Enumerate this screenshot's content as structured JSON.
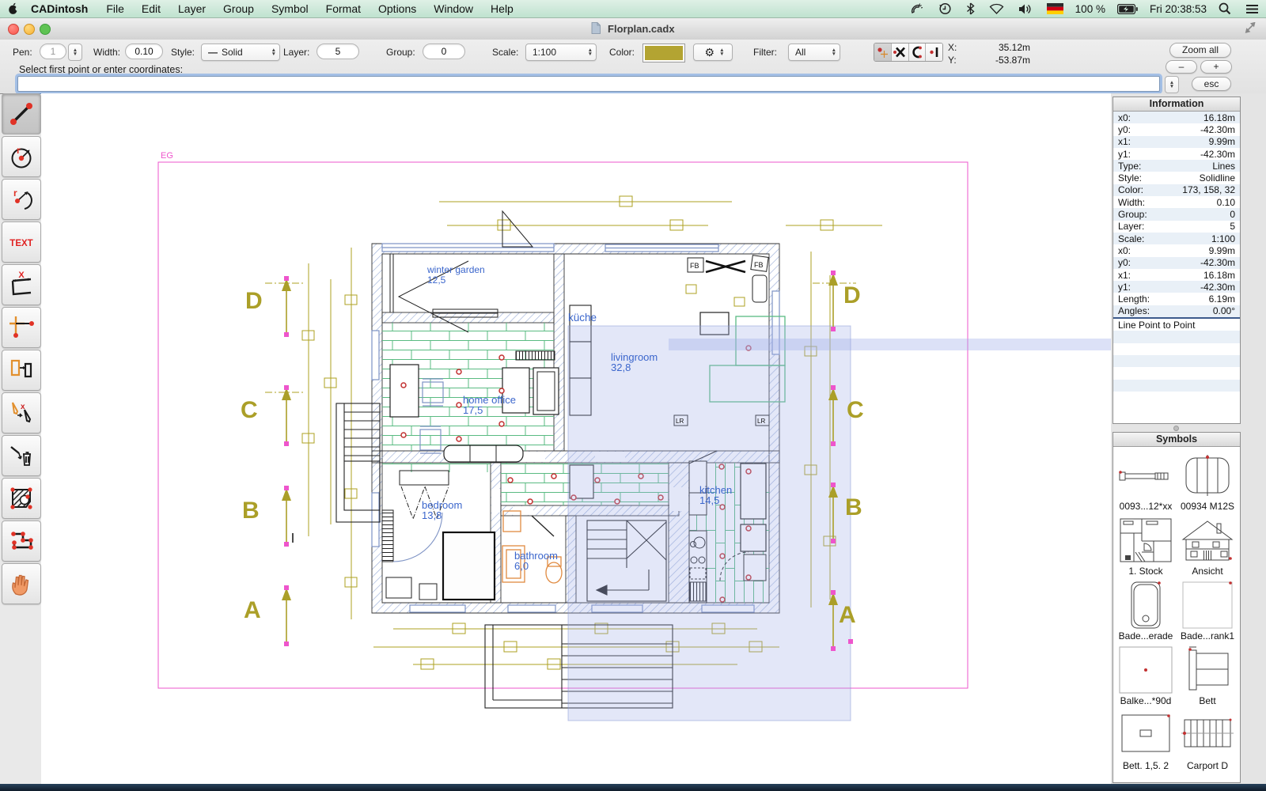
{
  "menu_bar": {
    "app_name": "CADintosh",
    "menus": [
      "File",
      "Edit",
      "Layer",
      "Group",
      "Symbol",
      "Format",
      "Options",
      "Window",
      "Help"
    ],
    "battery": "100 %",
    "clock": "Fri 20:38:53",
    "status_icons": [
      "phone-icon",
      "time-machine-icon",
      "bluetooth-icon",
      "wifi-icon",
      "volume-icon",
      "keyboard-flag-de-icon",
      "battery-icon",
      "spotlight-icon",
      "notification-center-icon"
    ]
  },
  "window": {
    "title": "Florplan.cadx"
  },
  "toolbar": {
    "pen_label": "Pen:",
    "pen": "1",
    "width_label": "Width:",
    "width": "0.10",
    "style_label": "Style:",
    "style_dash": "—",
    "style": "Solid",
    "layer_label": "Layer:",
    "layer": "5",
    "group_label": "Group:",
    "group": "0",
    "scale_label": "Scale:",
    "scale": "1:100",
    "color_label": "Color:",
    "gear": "⚙",
    "filter_label": "Filter:",
    "filter": "All",
    "x_label": "X:",
    "x_value": "35.12m",
    "y_label": "Y:",
    "y_value": "-53.87m",
    "zoom_all": "Zoom all",
    "zoom_out": "–",
    "zoom_in": "+",
    "esc": "esc"
  },
  "prompt": {
    "label": "Select first point or enter coordinates:",
    "value": ""
  },
  "tools": {
    "text_label": "TEXT",
    "r_label": "r",
    "x_label": "X",
    "names": [
      "line",
      "circle",
      "arc",
      "text",
      "dimension",
      "axis",
      "copy",
      "edit-copy",
      "delete",
      "hatch",
      "polyline",
      "pan"
    ]
  },
  "info_panel": {
    "title": "Information",
    "rows": [
      {
        "label": "x0:",
        "value": "16.18m"
      },
      {
        "label": "y0:",
        "value": "-42.30m"
      },
      {
        "label": "x1:",
        "value": "9.99m"
      },
      {
        "label": "y1:",
        "value": "-42.30m"
      },
      {
        "label": "Type:",
        "value": "Lines"
      },
      {
        "label": "Style:",
        "value": "Solidline"
      },
      {
        "label": "Color:",
        "value": "173, 158, 32"
      },
      {
        "label": "Width:",
        "value": "0.10"
      },
      {
        "label": "Group:",
        "value": "0"
      },
      {
        "label": "Layer:",
        "value": "5"
      },
      {
        "label": "Scale:",
        "value": "1:100"
      },
      {
        "label": "x0:",
        "value": "9.99m"
      },
      {
        "label": "y0:",
        "value": "-42.30m"
      },
      {
        "label": "x1:",
        "value": "16.18m"
      },
      {
        "label": "y1:",
        "value": "-42.30m"
      },
      {
        "label": "Length:",
        "value": "6.19m"
      },
      {
        "label": "Angles:",
        "value": "0.00°"
      }
    ],
    "mode": "Line Point to Point"
  },
  "symbols_panel": {
    "title": "Symbols",
    "items": [
      {
        "label": "0093...12*xx",
        "icon": "bolt"
      },
      {
        "label": "00934 M12S",
        "icon": "nut"
      },
      {
        "label": "1. Stock",
        "icon": "floorplan"
      },
      {
        "label": "Ansicht",
        "icon": "house-elevation"
      },
      {
        "label": "Bade...erade",
        "icon": "bathtub"
      },
      {
        "label": "Bade...rank1",
        "icon": "blank-frame"
      },
      {
        "label": "Balke...*90d",
        "icon": "beam"
      },
      {
        "label": "Bett",
        "icon": "bed"
      },
      {
        "label": "Bett. 1,5. 2",
        "icon": "bed-2"
      },
      {
        "label": "Carport D",
        "icon": "carport"
      }
    ]
  },
  "canvas": {
    "plan_label": "EG",
    "rooms": [
      {
        "name": "winter garden",
        "area": "12,5"
      },
      {
        "name": "küche",
        "area": ""
      },
      {
        "name": "livingroom",
        "area": "32,8"
      },
      {
        "name": "home office",
        "area": "17,5"
      },
      {
        "name": "bedroom",
        "area": "13,8"
      },
      {
        "name": "bathroom",
        "area": "6,0"
      },
      {
        "name": "kitchen",
        "area": "14,5"
      }
    ],
    "markers": {
      "left": [
        "D",
        "C",
        "B",
        "A"
      ],
      "right": [
        "D",
        "C",
        "B",
        "A"
      ]
    },
    "tags": {
      "fb": "FB",
      "lr": "LR"
    },
    "colors": {
      "dimension_olive": "#ada020",
      "frame_magenta": "#ee55cc",
      "tile_green": "#5abb82",
      "wall_hatch_blue": "#9db0d8",
      "room_label_blue": "#3b66cc",
      "fixture_orange": "#e08a40",
      "selection_blue": "#aab4e6",
      "red_dot": "#cc3333"
    }
  }
}
